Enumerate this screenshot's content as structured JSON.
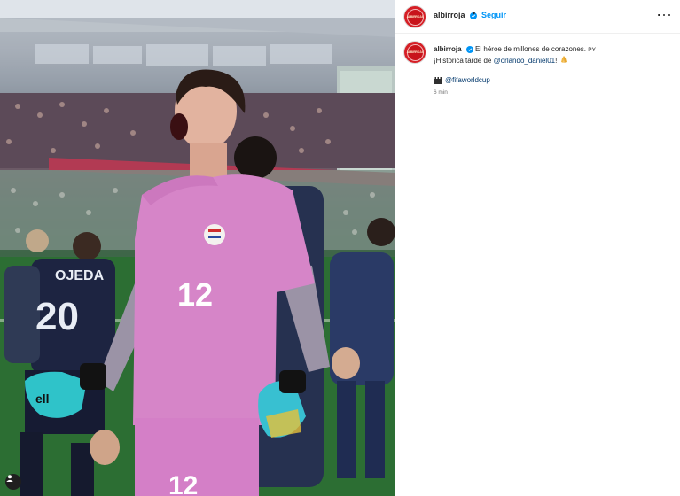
{
  "post": {
    "username": "albirroja",
    "separator": "•",
    "follow_label": "Seguir",
    "avatar_text": "ALBIRROJA",
    "caption_line1": "El héroe de millones de corazones.",
    "flag_code": "PY",
    "caption_line2_prefix": "¡Histórica tarde de ",
    "caption_mention": "@orlando_daniel01",
    "caption_line2_suffix": "!",
    "caption_link": "@fifaworldcup",
    "time_ago": "6 min"
  },
  "photo": {
    "player_number": "12",
    "teammate_name": "OJEDA",
    "teammate_number": "20",
    "glove_text": "ell",
    "other_number": "12"
  },
  "colors": {
    "follow": "#0095f6",
    "mention": "#00376b",
    "jersey": "#d685c8",
    "avatar": "#d61f26"
  },
  "icons": {
    "verified": "verified-badge-icon",
    "more": "more-options-icon",
    "user_tag": "user-tag-icon",
    "emoji": "praying-hands-icon",
    "clapper": "clapper-board-icon"
  }
}
